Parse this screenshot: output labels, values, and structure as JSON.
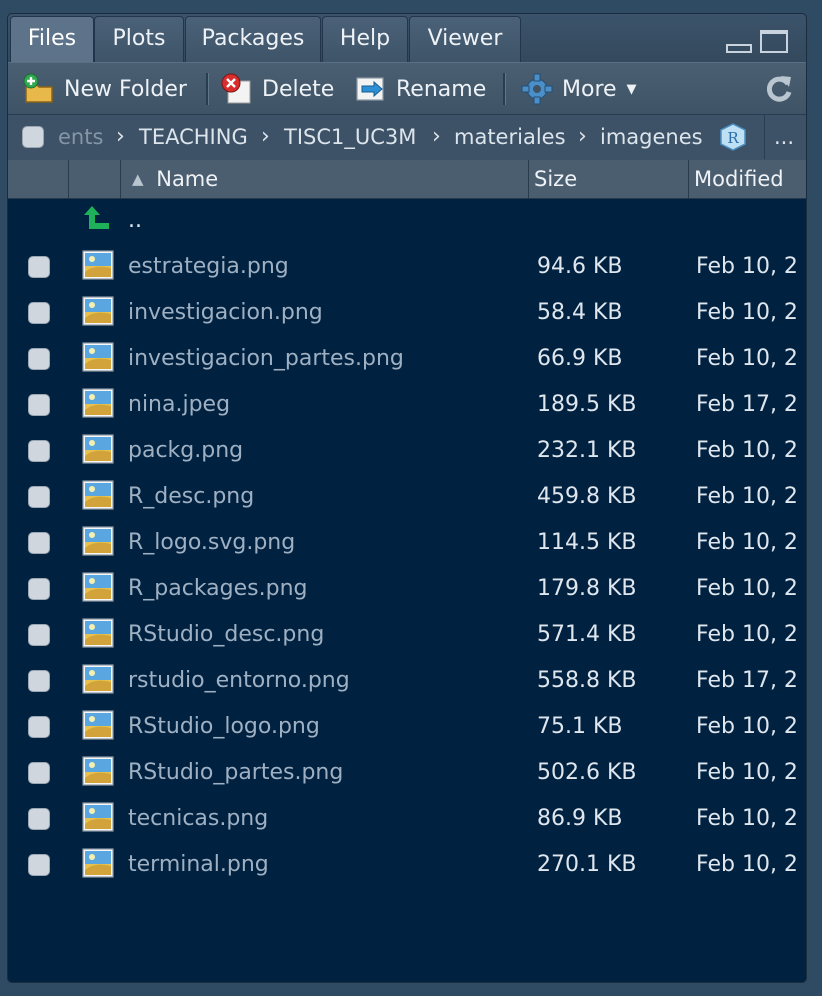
{
  "tabs": [
    {
      "label": "Files",
      "active": true
    },
    {
      "label": "Plots",
      "active": false
    },
    {
      "label": "Packages",
      "active": false
    },
    {
      "label": "Help",
      "active": false
    },
    {
      "label": "Viewer",
      "active": false
    }
  ],
  "toolbar": {
    "new_folder": "New Folder",
    "delete": "Delete",
    "rename": "Rename",
    "more": "More"
  },
  "path": {
    "segments": [
      "ents",
      "TEACHING",
      "TISC1_UC3M",
      "materiales",
      "imagenes"
    ],
    "overflow": "..."
  },
  "columns": {
    "name": "Name",
    "size": "Size",
    "modified": "Modified"
  },
  "parent_dir": "..",
  "files": [
    {
      "name": "estrategia.png",
      "size": "94.6 KB",
      "modified": "Feb 10, 2"
    },
    {
      "name": "investigacion.png",
      "size": "58.4 KB",
      "modified": "Feb 10, 2"
    },
    {
      "name": "investigacion_partes.png",
      "size": "66.9 KB",
      "modified": "Feb 10, 2"
    },
    {
      "name": "nina.jpeg",
      "size": "189.5 KB",
      "modified": "Feb 17, 2"
    },
    {
      "name": "packg.png",
      "size": "232.1 KB",
      "modified": "Feb 10, 2"
    },
    {
      "name": "R_desc.png",
      "size": "459.8 KB",
      "modified": "Feb 10, 2"
    },
    {
      "name": "R_logo.svg.png",
      "size": "114.5 KB",
      "modified": "Feb 10, 2"
    },
    {
      "name": "R_packages.png",
      "size": "179.8 KB",
      "modified": "Feb 10, 2"
    },
    {
      "name": "RStudio_desc.png",
      "size": "571.4 KB",
      "modified": "Feb 10, 2"
    },
    {
      "name": "rstudio_entorno.png",
      "size": "558.8 KB",
      "modified": "Feb 17, 2"
    },
    {
      "name": "RStudio_logo.png",
      "size": "75.1 KB",
      "modified": "Feb 10, 2"
    },
    {
      "name": "RStudio_partes.png",
      "size": "502.6 KB",
      "modified": "Feb 10, 2"
    },
    {
      "name": "tecnicas.png",
      "size": "86.9 KB",
      "modified": "Feb 10, 2"
    },
    {
      "name": "terminal.png",
      "size": "270.1 KB",
      "modified": "Feb 10, 2"
    }
  ],
  "icons": {
    "new_folder": "new-folder-icon",
    "delete": "delete-icon",
    "rename": "rename-icon",
    "more": "gear-icon",
    "refresh": "refresh-icon",
    "parent": "up-arrow-icon",
    "file": "image-file-icon",
    "project": "r-project-icon"
  },
  "colors": {
    "pane_bg": "#002240",
    "file_name": "#9fb0c3",
    "parent_arrow": "#1fb15a"
  }
}
